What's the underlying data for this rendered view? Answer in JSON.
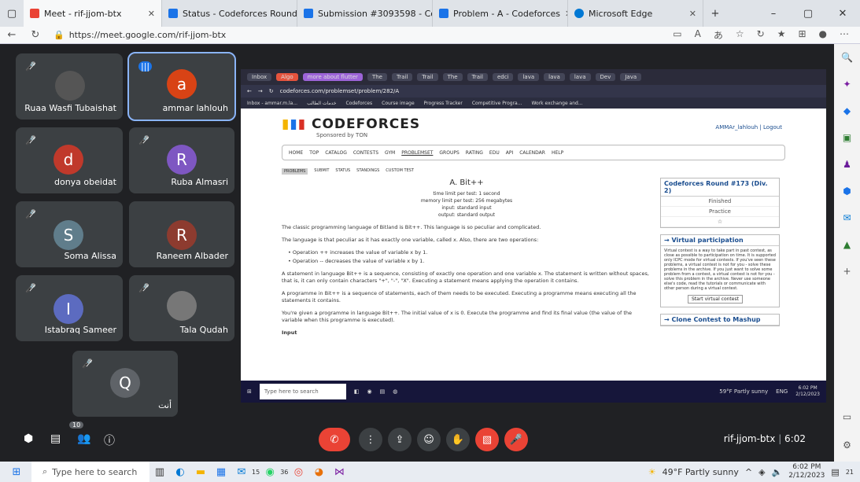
{
  "browser": {
    "tabs": [
      {
        "label": "Meet - rif-jjom-btx",
        "color": "#ea4335",
        "active": true
      },
      {
        "label": "Status - Codeforces Round #14·",
        "color": "#1a73e8",
        "active": false
      },
      {
        "label": "Submission #3093598 - Codefor·",
        "color": "#1a73e8",
        "active": false
      },
      {
        "label": "Problem - A - Codeforces",
        "color": "#1a73e8",
        "active": false
      },
      {
        "label": "Microsoft Edge",
        "color": "#0078d4",
        "active": false
      }
    ],
    "url": "https://meet.google.com/rif-jjom-btx",
    "new_tab": "+",
    "win_min": "–",
    "win_max": "▢",
    "win_close": "✕"
  },
  "participants": [
    {
      "name": "Ruaa Wasfi Tubaishat",
      "initial": "",
      "color": "#555"
    },
    {
      "name": "ammar lahlouh",
      "initial": "a",
      "color": "#d84315"
    },
    {
      "name": "donya obeidat",
      "initial": "d",
      "color": "#c0392b"
    },
    {
      "name": "Ruba Almasri",
      "initial": "R",
      "color": "#7e57c2"
    },
    {
      "name": "Soma Alissa",
      "initial": "S",
      "color": "#607d8b"
    },
    {
      "name": "Raneem Albader",
      "initial": "R",
      "color": "#8d3b2f"
    },
    {
      "name": "Istabraq Sameer",
      "initial": "I",
      "color": "#5c6bc0"
    },
    {
      "name": "Tala Qudah",
      "initial": "",
      "color": "#777"
    },
    {
      "name": "أنت",
      "initial": "Q",
      "color": "#5f6368"
    }
  ],
  "shared": {
    "inner_tabs": [
      "Inbox",
      "Algo",
      "more about flutter",
      "The",
      "Trail",
      "Trail",
      "The",
      "Trail",
      "edci",
      "lava",
      "lava",
      "lava",
      "Dev",
      "Java"
    ],
    "inner_url": "codeforces.com/problemset/problem/282/A",
    "bookmarks": [
      "Inbox - ammar.m.la...",
      "خدمات الطالب",
      "Codeforces",
      "Course image",
      "Progress Tracker",
      "Competitive Progra...",
      "Work exchange and..."
    ],
    "cf_logo": "CODEFORCES",
    "cf_sponsor": "Sponsored by TON",
    "cf_user": "AMMAr_lahlouh | Logout",
    "cf_menu": [
      "HOME",
      "TOP",
      "CATALOG",
      "CONTESTS",
      "GYM",
      "PROBLEMSET",
      "GROUPS",
      "RATING",
      "EDU",
      "API",
      "CALENDAR",
      "HELP"
    ],
    "cf_submenu": [
      "PROBLEMS",
      "SUBMIT",
      "STATUS",
      "STANDINGS",
      "CUSTOM TEST"
    ],
    "problem_title": "A. Bit++",
    "time_limit": "time limit per test: 1 second",
    "memory_limit": "memory limit per test: 256 megabytes",
    "input": "input: standard input",
    "output": "output: standard output",
    "para1": "The classic programming language of Bitland is Bit++. This language is so peculiar and complicated.",
    "para2": "The language is that peculiar as it has exactly one variable, called x. Also, there are two operations:",
    "op1": "• Operation ++ increases the value of variable x by 1.",
    "op2": "• Operation -- decreases the value of variable x by 1.",
    "para3": "A statement in language Bit++ is a sequence, consisting of exactly one operation and one variable x. The statement is written without spaces, that is, it can only contain characters \"+\", \"-\", \"X\". Executing a statement means applying the operation it contains.",
    "para4": "A programme in Bit++ is a sequence of statements, each of them needs to be executed. Executing a programme means executing all the statements it contains.",
    "para5": "You're given a programme in language Bit++. The initial value of x is 0. Execute the programme and find its final value (the value of the variable when this programme is executed).",
    "input_head": "Input",
    "round_title": "Codeforces Round #173 (Div. 2)",
    "finished": "Finished",
    "practice": "Practice",
    "virtual_title": "→ Virtual participation",
    "virtual_text": "Virtual contest is a way to take part in past contest, as close as possible to participation on time. It is supported only ICPC mode for virtual contests. If you've seen these problems, a virtual contest is not for you - solve these problems in the archive. If you just want to solve some problem from a contest, a virtual contest is not for you - solve this problem in the archive. Never use someone else's code, read the tutorials or communicate with other person during a virtual contest.",
    "start_virtual": "Start virtual contest",
    "clone_title": "→ Clone Contest to Mashup",
    "inner_search": "Type here to search",
    "inner_weather": "59°F Partly sunny",
    "inner_lang": "ENG",
    "inner_time": "6:02 PM",
    "inner_date": "2/12/2023"
  },
  "meet": {
    "code": "rif-jjom-btx",
    "time": "6:02",
    "participants_count": "10"
  },
  "taskbar": {
    "search_placeholder": "Type here to search",
    "weather": "49°F Partly sunny",
    "time": "6:02 PM",
    "date": "2/12/2023",
    "notif_count": "21",
    "badge_15": "15",
    "badge_36": "36"
  }
}
